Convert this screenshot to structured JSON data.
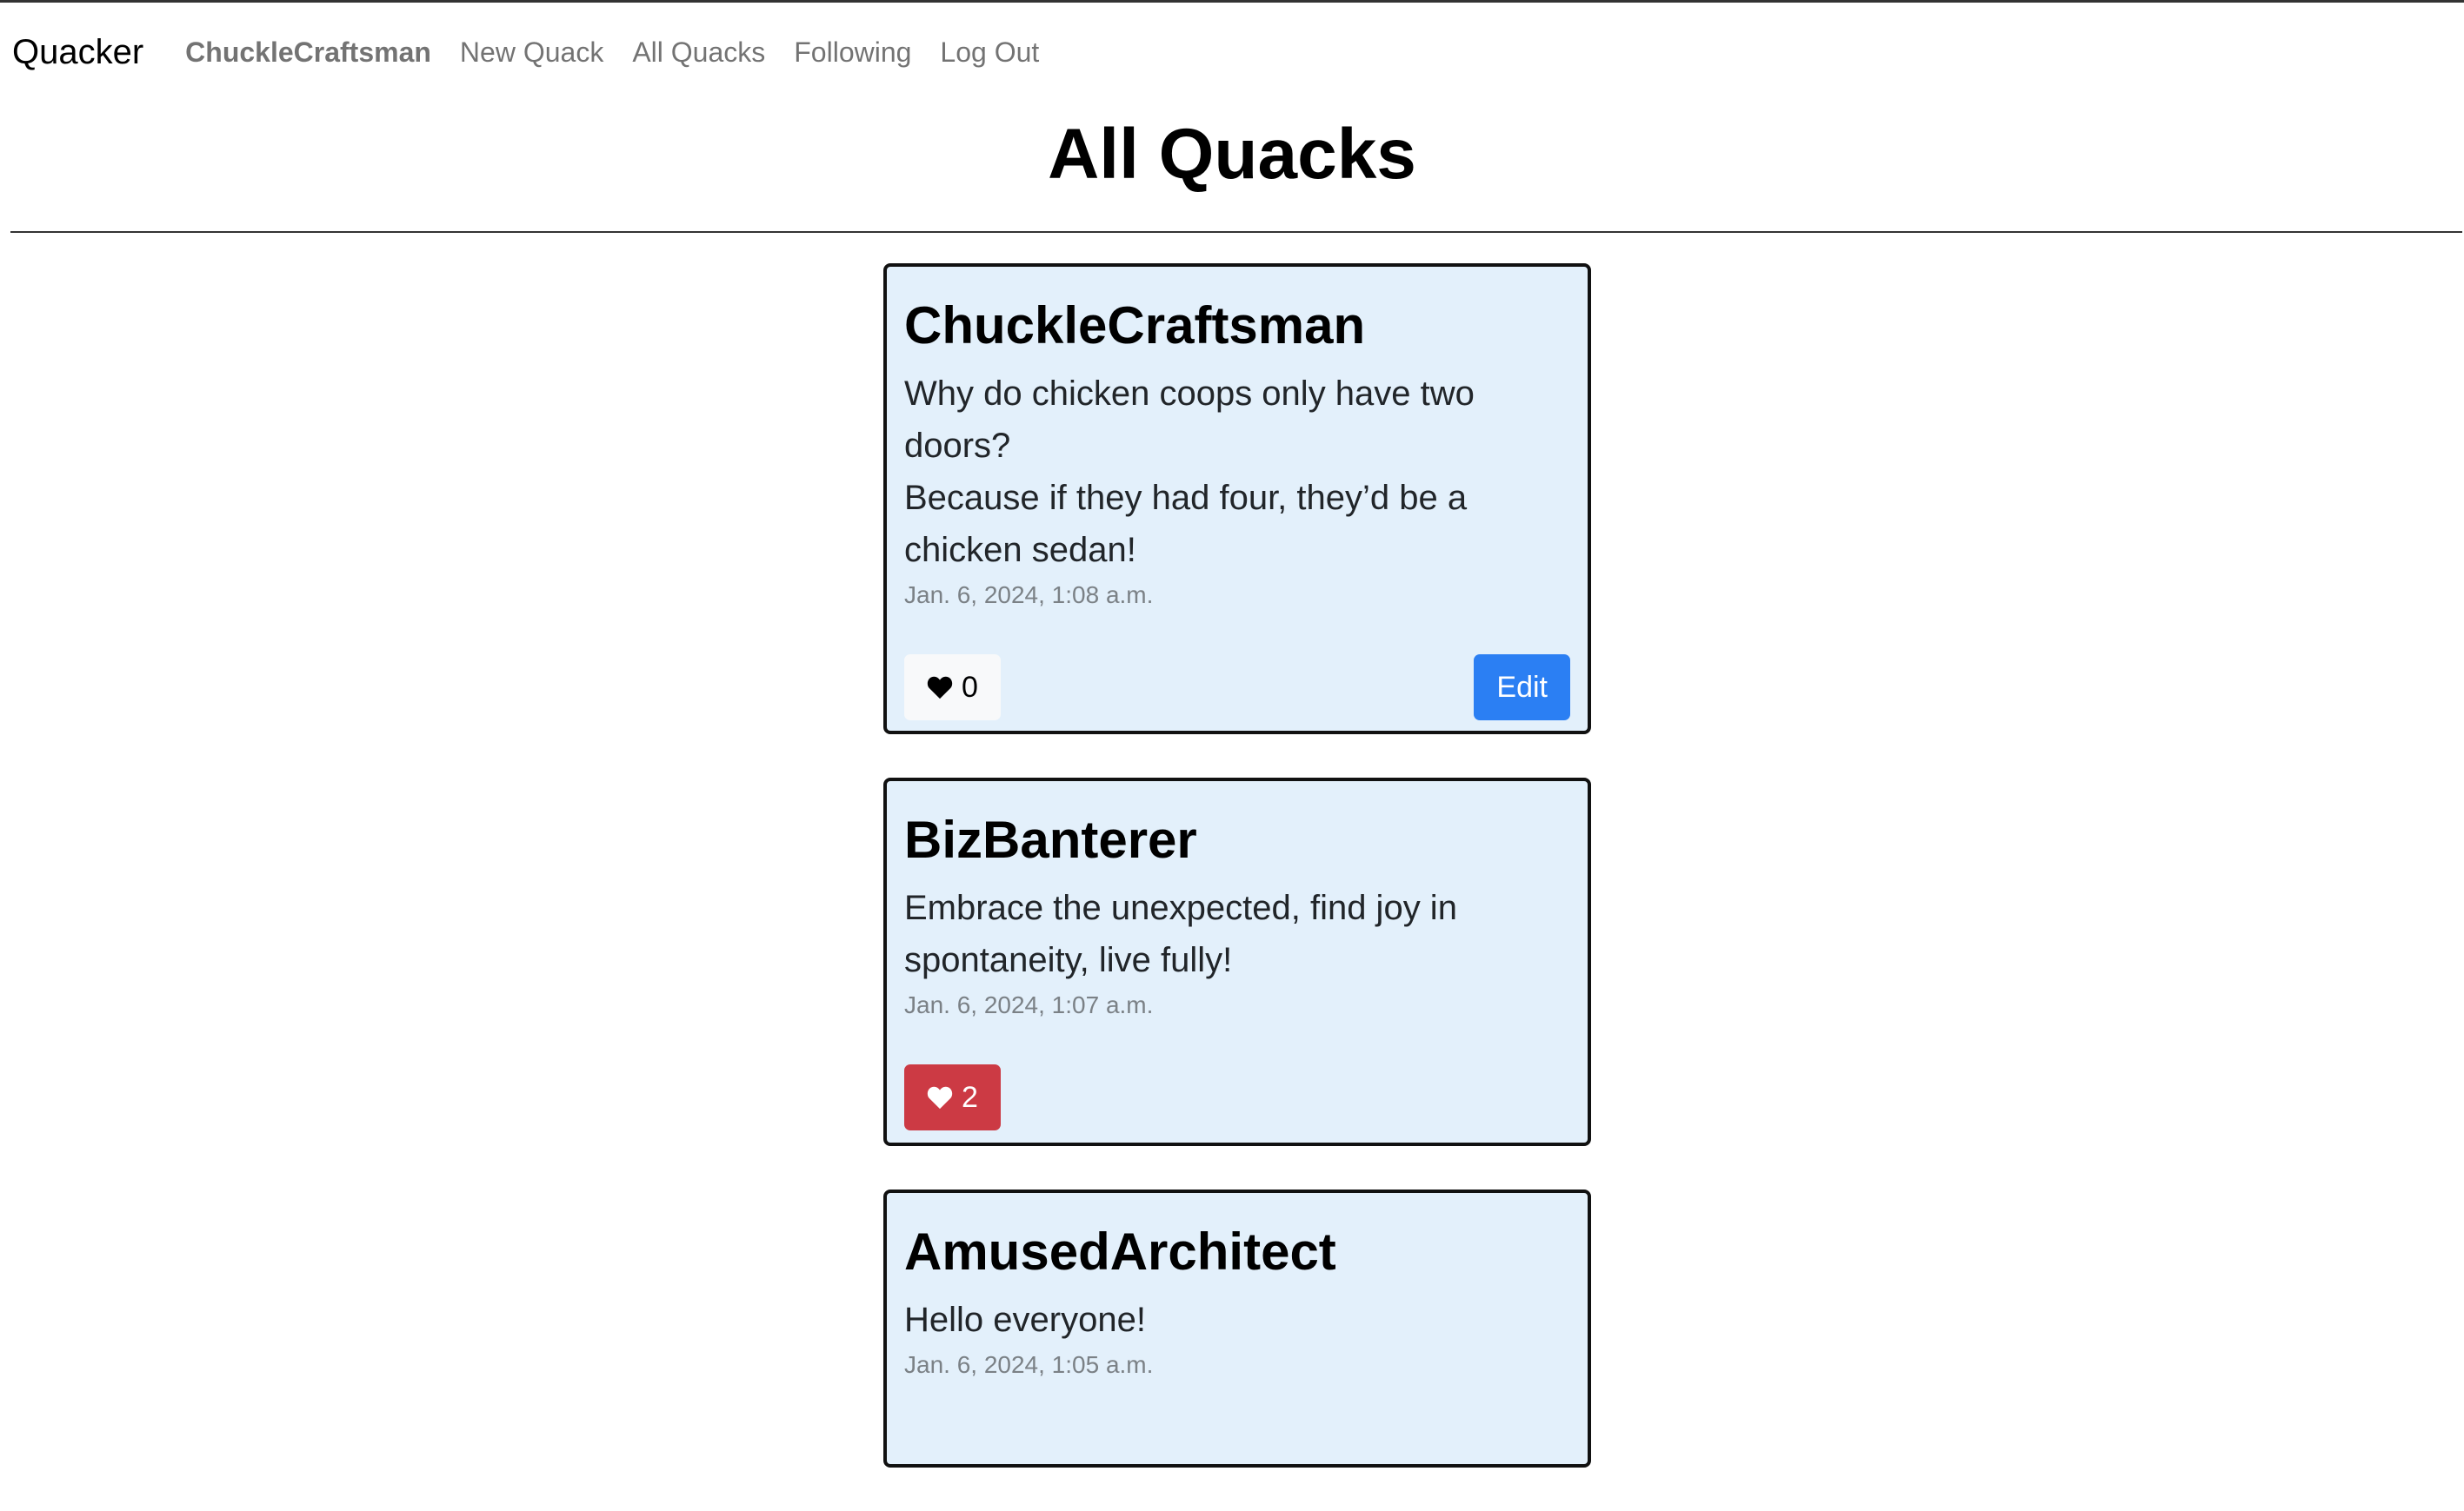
{
  "nav": {
    "brand": "Quacker",
    "user": "ChuckleCraftsman",
    "new_quack": "New Quack",
    "all_quacks": "All Quacks",
    "following": "Following",
    "log_out": "Log Out"
  },
  "page": {
    "title": "All Quacks"
  },
  "quacks": [
    {
      "author": "ChuckleCraftsman",
      "lines": [
        "Why do chicken coops only have two doors?",
        "Because if they had four, they’d be a chicken sedan!"
      ],
      "timestamp": "Jan. 6, 2024, 1:08 a.m.",
      "likes": "0",
      "liked": false,
      "edit_label": "Edit"
    },
    {
      "author": "BizBanterer",
      "lines": [
        "Embrace the unexpected, find joy in spontaneity, live fully!"
      ],
      "timestamp": "Jan. 6, 2024, 1:07 a.m.",
      "likes": "2",
      "liked": true
    },
    {
      "author": "AmusedArchitect",
      "lines": [
        "Hello everyone!"
      ],
      "timestamp": "Jan. 6, 2024, 1:05 a.m."
    }
  ],
  "colors": {
    "card_bg": "#e3f0fb",
    "liked": "#cc3a44",
    "edit": "#2b7ff3"
  },
  "icons": {
    "like": "heart-icon"
  }
}
